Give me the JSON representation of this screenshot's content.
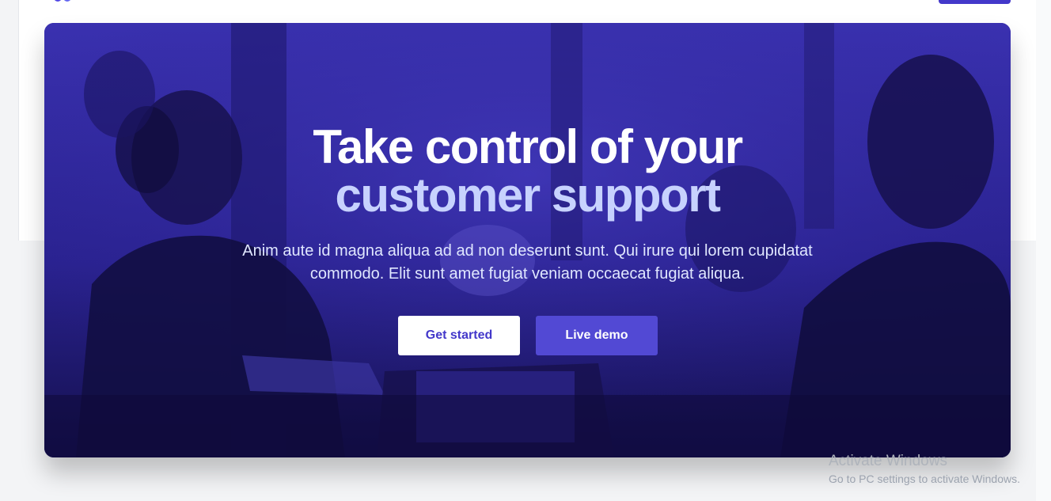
{
  "hero": {
    "headline_line1": "Take control of your",
    "headline_line2": "customer support",
    "description": "Anim aute id magna aliqua ad ad non deserunt sunt. Qui irure qui lorem cupidatat commodo. Elit sunt amet fugiat veniam occaecat fugiat aliqua.",
    "primary_button": "Get started",
    "secondary_button": "Live demo"
  },
  "watermark": {
    "title": "Activate Windows",
    "subtitle": "Go to PC settings to activate Windows."
  },
  "colors": {
    "accent": "#4338ca",
    "hero_overlay": "#2b238e",
    "headline_highlight": "#c7d2fe"
  },
  "icons": {
    "brand_logo": "logo-mark"
  }
}
